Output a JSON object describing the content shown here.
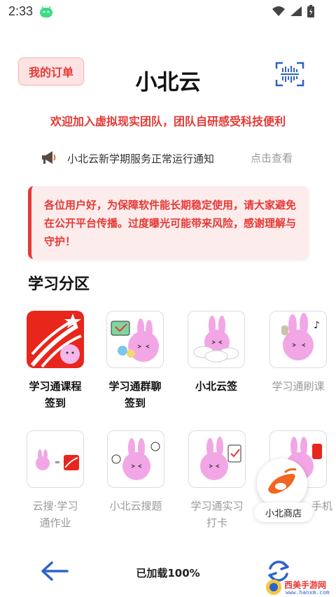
{
  "status_bar": {
    "time": "2:33"
  },
  "header": {
    "order_button": "我的订单",
    "title": "小北云",
    "scan_icon": "scan-icon"
  },
  "welcome": "欢迎加入虚拟现实团队，团队自研感受科技便利",
  "notice": {
    "icon": "megaphone-icon",
    "text": "小北云新学期服务正常运行通知",
    "action": "点击查看"
  },
  "warning": {
    "text": "各位用户好，为保障软件能长期稳定使用，请大家避免在公开平台传播。过度曝光可能带来风险，感谢理解与守护！"
  },
  "section": {
    "title": "学习分区"
  },
  "tiles": [
    {
      "line1": "学习通课程",
      "line2": "签到",
      "icon": "chaoxing-logo-icon"
    },
    {
      "line1": "学习通群聊",
      "line2": "签到",
      "icon": "bunny-chat-icon"
    },
    {
      "line1": "小北云签",
      "line2": "",
      "icon": "bunny-cloud-icon"
    },
    {
      "line1": "学习通刷课",
      "line2": "",
      "icon": "bunny-music-icon"
    },
    {
      "line1": "云搜·学习",
      "line2": "通作业",
      "icon": "bunny-search-icon"
    },
    {
      "line1": "小北云搜题",
      "line2": "",
      "icon": "bunny-question-icon"
    },
    {
      "line1": "学习通实习",
      "line2": "打卡",
      "icon": "bunny-clipboard-icon"
    },
    {
      "line1": "手机",
      "line2": "",
      "icon": "bunny-phone-icon"
    }
  ],
  "floating": {
    "label": "小北商店",
    "icon": "shop-logo-icon"
  },
  "bottom": {
    "status": "已加载100%"
  },
  "watermark": {
    "title": "西美手游网",
    "url": "www.hanxm.com"
  },
  "colors": {
    "accent_red": "#e53935",
    "accent_blue": "#2d63c8",
    "bunny_pink": "#f2a6e6"
  }
}
